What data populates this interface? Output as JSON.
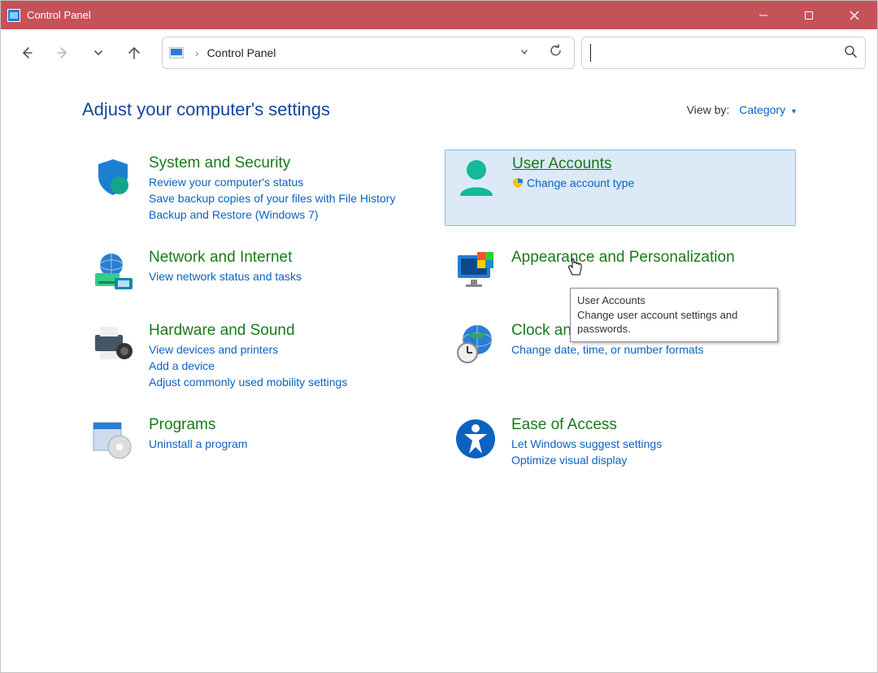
{
  "window": {
    "title": "Control Panel"
  },
  "addressbar": {
    "path": "Control Panel"
  },
  "header": {
    "title": "Adjust your computer's settings"
  },
  "viewby": {
    "label": "View by:",
    "value": "Category"
  },
  "categories": {
    "system_security": {
      "title": "System and Security",
      "links": [
        "Review your computer's status",
        "Save backup copies of your files with File History",
        "Backup and Restore (Windows 7)"
      ]
    },
    "network": {
      "title": "Network and Internet",
      "links": [
        "View network status and tasks"
      ]
    },
    "hardware": {
      "title": "Hardware and Sound",
      "links": [
        "View devices and printers",
        "Add a device",
        "Adjust commonly used mobility settings"
      ]
    },
    "programs": {
      "title": "Programs",
      "links": [
        "Uninstall a program"
      ]
    },
    "user_accounts": {
      "title": "User Accounts",
      "links": [
        "Change account type"
      ]
    },
    "appearance": {
      "title": "Appearance and Personalization",
      "links": []
    },
    "clock": {
      "title": "Clock and Region",
      "links": [
        "Change date, time, or number formats"
      ]
    },
    "ease": {
      "title": "Ease of Access",
      "links": [
        "Let Windows suggest settings",
        "Optimize visual display"
      ]
    }
  },
  "tooltip": {
    "title": "User Accounts",
    "body": "Change user account settings and passwords."
  }
}
